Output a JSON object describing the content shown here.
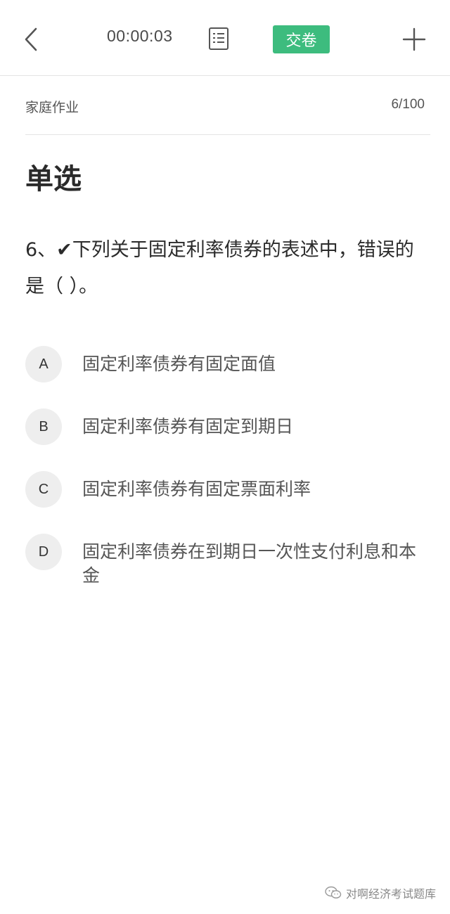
{
  "topbar": {
    "back_icon": "chevron-left-icon",
    "timer": "00:00:03",
    "sheet_icon": "answer-sheet-icon",
    "submit_label": "交卷",
    "submit_color": "#3dbc7e",
    "add_icon": "plus-icon"
  },
  "subheader": {
    "category": "家庭作业",
    "progress": "6/100"
  },
  "question": {
    "type_label": "单选",
    "text": "6、✔下列关于固定利率债券的表述中，错误的是（ ）。"
  },
  "options": [
    {
      "letter": "A",
      "text": "固定利率债券有固定面值"
    },
    {
      "letter": "B",
      "text": "固定利率债券有固定到期日"
    },
    {
      "letter": "C",
      "text": "固定利率债券有固定票面利率"
    },
    {
      "letter": "D",
      "text": "固定利率债券在到期日一次性支付利息和本金"
    }
  ],
  "watermark": {
    "icon": "wechat-icon",
    "text": "对啊经济考试题库"
  }
}
